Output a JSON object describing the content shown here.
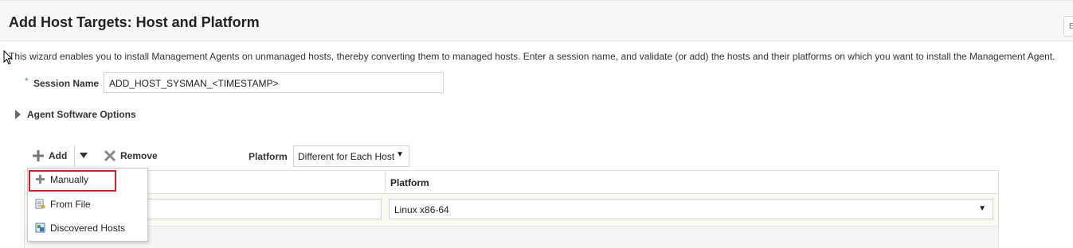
{
  "page_title": "Add Host Targets: Host and Platform",
  "intro_text": "This wizard enables you to install Management Agents on unmanaged hosts, thereby converting them to managed hosts. Enter a session name, and validate (or add) the hosts and their platforms on which you want to install the Management Agent.",
  "session": {
    "required_mark": "*",
    "label": "Session Name",
    "value": "ADD_HOST_SYSMAN_<TIMESTAMP>"
  },
  "agent_software_options": {
    "label": "Agent Software Options"
  },
  "toolbar": {
    "add_label": "Add",
    "remove_label": "Remove",
    "platform_label": "Platform",
    "platform_value": "Different for Each Host"
  },
  "add_menu": {
    "items": [
      {
        "label": "Manually",
        "icon": "plus-icon",
        "highlighted": true
      },
      {
        "label": "From File",
        "icon": "file-list-icon"
      },
      {
        "label": "Discovered Hosts",
        "icon": "discovered-hosts-icon"
      }
    ]
  },
  "table": {
    "columns": [
      "",
      "Platform"
    ],
    "rows": [
      {
        "host": "",
        "platform": "Linux x86-64"
      }
    ]
  },
  "colors": {
    "highlight_border": "#cc1f2e",
    "required_star": "#4b8bd0"
  }
}
